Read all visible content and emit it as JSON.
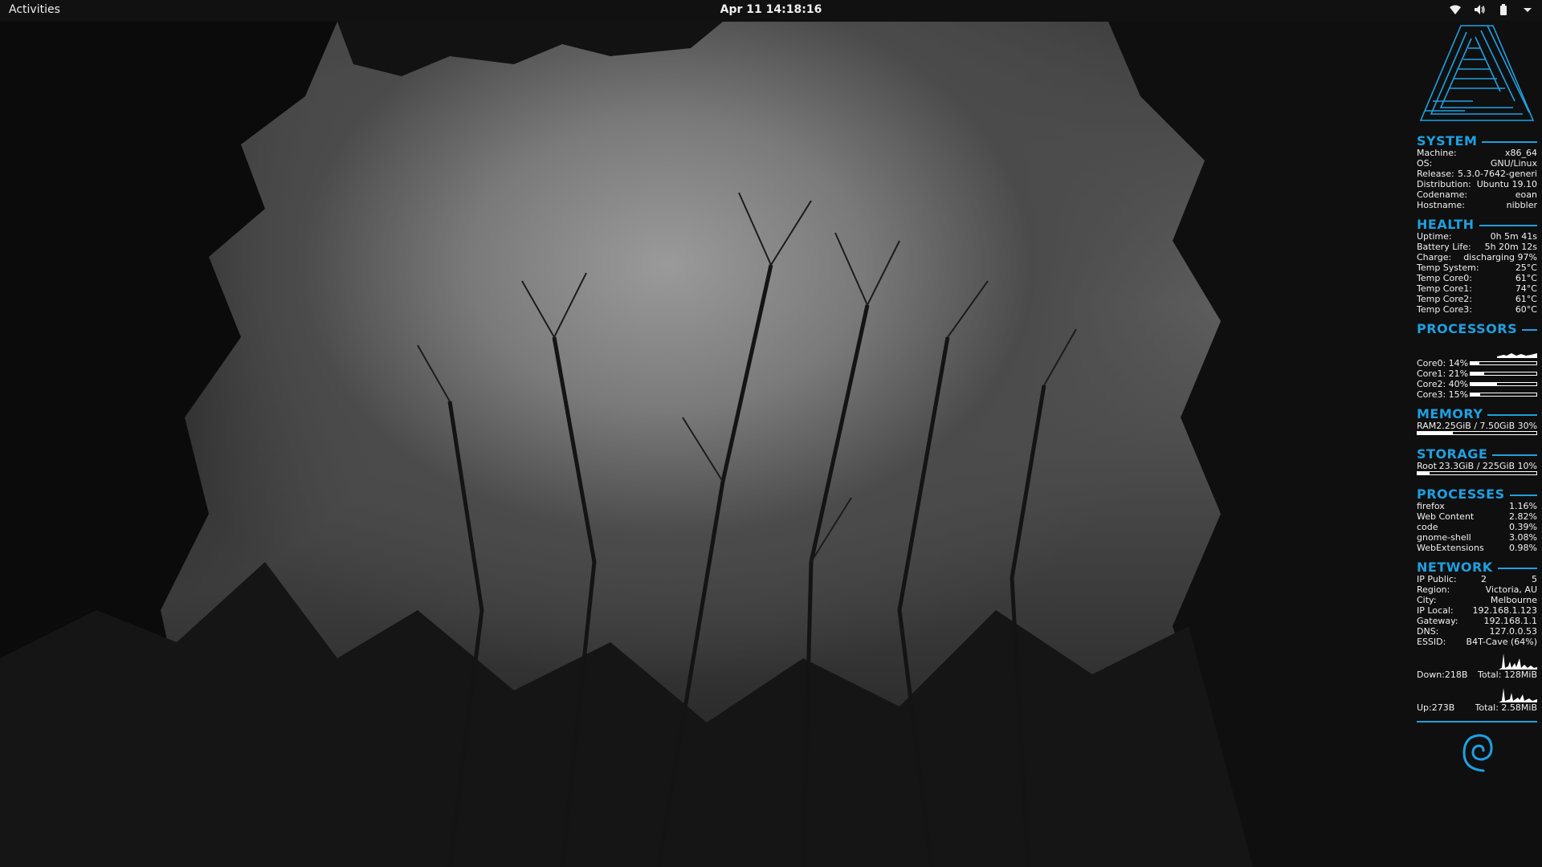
{
  "topbar": {
    "activities_label": "Activities",
    "clock": "Apr 11  14:18:16",
    "tray_icons": [
      "wifi-icon",
      "volume-icon",
      "battery-icon",
      "chevron-down-icon"
    ]
  },
  "colors": {
    "accent": "#1ea0e0",
    "topbar_bg": "#111111",
    "text": "#f0f0f0"
  },
  "system": {
    "title": "SYSTEM",
    "rows": [
      {
        "k": "Machine:",
        "v": "x86_64"
      },
      {
        "k": "OS:",
        "v": "GNU/Linux"
      },
      {
        "k": "Release:",
        "v": "5.3.0-7642-generi"
      },
      {
        "k": "Distribution:",
        "v": "Ubuntu 19.10"
      },
      {
        "k": "Codename:",
        "v": "eoan"
      },
      {
        "k": "Hostname:",
        "v": "nibbler"
      }
    ]
  },
  "health": {
    "title": "HEALTH",
    "rows": [
      {
        "k": "Uptime:",
        "v": "0h 5m 41s"
      },
      {
        "k": "Battery Life:",
        "v": "5h 20m 12s"
      },
      {
        "k": "Charge:",
        "v": "discharging 97%"
      },
      {
        "k": "Temp System:",
        "v": "25°C"
      },
      {
        "k": "Temp Core0:",
        "v": "61°C"
      },
      {
        "k": "Temp Core1:",
        "v": "74°C"
      },
      {
        "k": "Temp Core2:",
        "v": "61°C"
      },
      {
        "k": "Temp Core3:",
        "v": "60°C"
      }
    ]
  },
  "processors": {
    "title": "PROCESSORS",
    "cores": [
      {
        "label": "Core0: 14%",
        "percent": 14
      },
      {
        "label": "Core1: 21%",
        "percent": 21
      },
      {
        "label": "Core2: 40%",
        "percent": 40
      },
      {
        "label": "Core3: 15%",
        "percent": 15
      }
    ]
  },
  "memory": {
    "title": "MEMORY",
    "k": "RAM",
    "v": "2.25GiB / 7.50GiB 30%",
    "percent": 30
  },
  "storage": {
    "title": "STORAGE",
    "k": "Root",
    "v": "23.3GiB / 225GiB 10%",
    "percent": 10
  },
  "processes": {
    "title": "PROCESSES",
    "rows": [
      {
        "k": "firefox",
        "v": "1.16%"
      },
      {
        "k": "Web Content",
        "v": "2.82%"
      },
      {
        "k": "code",
        "v": "0.39%"
      },
      {
        "k": "gnome-shell",
        "v": "3.08%"
      },
      {
        "k": "WebExtensions",
        "v": "0.98%"
      }
    ]
  },
  "network": {
    "title": "NETWORK",
    "rows": [
      {
        "k": "IP Public:",
        "v": "2                5"
      },
      {
        "k": "Region:",
        "v": "Victoria, AU"
      },
      {
        "k": "City:",
        "v": "Melbourne"
      },
      {
        "k": "IP Local:",
        "v": "192.168.1.123"
      },
      {
        "k": "Gateway:",
        "v": "192.168.1.1"
      },
      {
        "k": "DNS:",
        "v": "127.0.0.53"
      },
      {
        "k": "ESSID:",
        "v": "B4T-Cave (64%)"
      }
    ],
    "down": {
      "k": "Down:218B",
      "v": "Total: 128MiB"
    },
    "up": {
      "k": "Up:273B",
      "v": "Total: 2.58MiB"
    }
  }
}
